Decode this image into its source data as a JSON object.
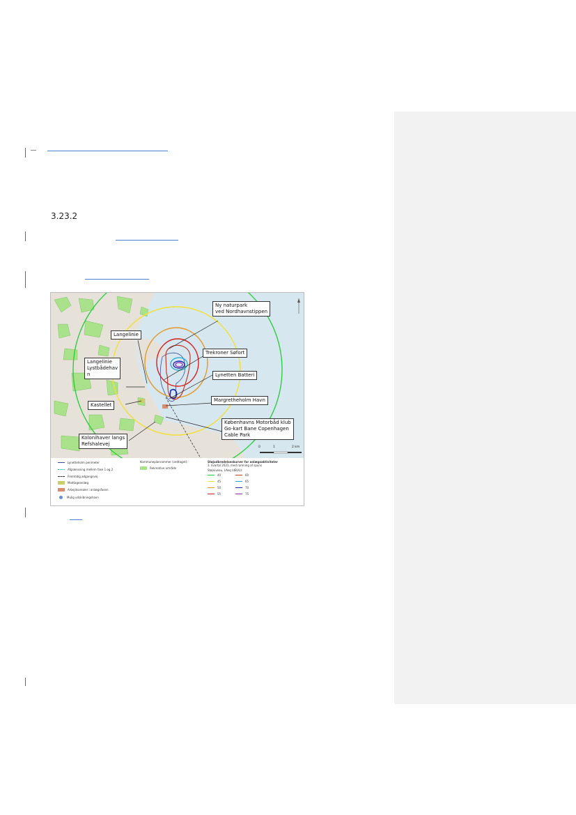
{
  "section": {
    "number": "3.23.2"
  },
  "map": {
    "labels": [
      {
        "id": "ny-naturpark",
        "text": "Ny naturpark\nved Nordhavnstippen"
      },
      {
        "id": "langelinie",
        "text": "Langelinie"
      },
      {
        "id": "trekroner",
        "text": "Trekroner Søfort"
      },
      {
        "id": "langelinie-lystbaadehavn",
        "text": "Langelinie\nLystbådehav\nn"
      },
      {
        "id": "lynetten-batteri",
        "text": "Lynetten Batteri"
      },
      {
        "id": "margretheholm",
        "text": "Margretheholm Havn"
      },
      {
        "id": "kastellet",
        "text": "Kastellet"
      },
      {
        "id": "motorbaad",
        "text": "Københavns Motorbåd klub\nGo-kart Bane Copenhagen\nCable Park"
      },
      {
        "id": "kolonihaver",
        "text": "Kolonihaver langs\nRefshalevej"
      }
    ],
    "scale_labels": [
      "0",
      "1",
      "2 km"
    ],
    "legend": {
      "col1": [
        {
          "text": "Lynetteholm perimeter",
          "color": "#3a4a9a",
          "kind": "line"
        },
        {
          "text": "Afgrænsning mellem fase 1 og 2",
          "color": "#2aa6b0",
          "kind": "dotted"
        },
        {
          "text": "Fremtidig adgangsvej",
          "color": "#333333",
          "kind": "dashed"
        },
        {
          "text": "Modtageanlæg",
          "color": "#c8cf68",
          "kind": "box"
        },
        {
          "text": "Arbejdsarealer i anlægsfasen",
          "color": "#d98d70",
          "kind": "box"
        },
        {
          "text": "Mulig udskibningshavn",
          "color": "#6a8fd0",
          "kind": "circle"
        }
      ],
      "col2_title": "Kommuneplanrammer (vedtaget):",
      "col2": [
        {
          "text": "Rekreative område",
          "color": "#a9e28a",
          "kind": "box"
        }
      ],
      "col3_title": "Støjudbredelseskurver for anlægsaktiviteter",
      "col3_subtitle": "3. kvartal 2023, med ramning af spuns",
      "col3_unit": "Støjniveau, LAeq (dB(A)):",
      "contours": [
        {
          "level": "40",
          "color": "#2ecc40"
        },
        {
          "level": "60",
          "color": "#c0392b"
        },
        {
          "level": "45",
          "color": "#f1e03a"
        },
        {
          "level": "65",
          "color": "#1fa8c9"
        },
        {
          "level": "50",
          "color": "#e09a2a"
        },
        {
          "level": "70",
          "color": "#1c2bb0"
        },
        {
          "level": "55",
          "color": "#d62020"
        },
        {
          "level": "75",
          "color": "#8e2ab0"
        }
      ]
    }
  }
}
